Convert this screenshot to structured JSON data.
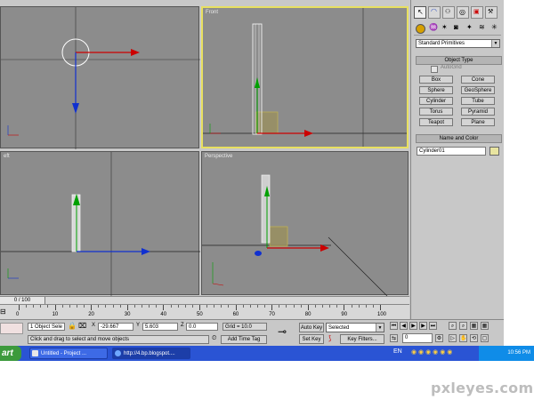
{
  "viewports": {
    "front_label": "Front",
    "left_label": "eft",
    "perspective_label": "Perspective"
  },
  "command_panel": {
    "category_select": "Standard Primitives",
    "object_type_header": "Object Type",
    "autogrid_label": "AutoGrid",
    "buttons": [
      "Box",
      "Cone",
      "Sphere",
      "GeoSphere",
      "Cylinder",
      "Tube",
      "Torus",
      "Pyramid",
      "Teapot",
      "Plane"
    ],
    "name_color_header": "Name and Color",
    "object_name": "Cylinder01",
    "object_color": "#e8e4a0"
  },
  "timeline": {
    "slider_label": "0 / 100",
    "ticks": [
      "0",
      "10",
      "20",
      "30",
      "40",
      "50",
      "60",
      "70",
      "80",
      "90",
      "100"
    ]
  },
  "status": {
    "selection": "1 Object Sele",
    "x_label": "X",
    "x_value": "-29.667",
    "y_label": "Y",
    "y_value": "5.603",
    "z_label": "Z",
    "z_value": "0.0",
    "grid": "Grid = 10.0",
    "prompt": "Click and drag to select and move objects",
    "add_time_tag": "Add Time Tag",
    "auto_key": "Auto Key",
    "set_key": "Set Key",
    "key_mode": "Selected",
    "key_filters": "Key Filters...",
    "frame": "0"
  },
  "taskbar": {
    "start": "art",
    "items": [
      "Untitled  - Project ...",
      "http://4.bp.blogspot...."
    ],
    "clock": "10:56 PM"
  },
  "watermark": "pxleyes.com",
  "colors": {
    "viewport_bg": "#8c8c8c",
    "active_border": "#e8e060",
    "axis_x": "#cc0000",
    "axis_y": "#00a000",
    "axis_z": "#1030d0",
    "taskbar": "#2a54d4"
  }
}
